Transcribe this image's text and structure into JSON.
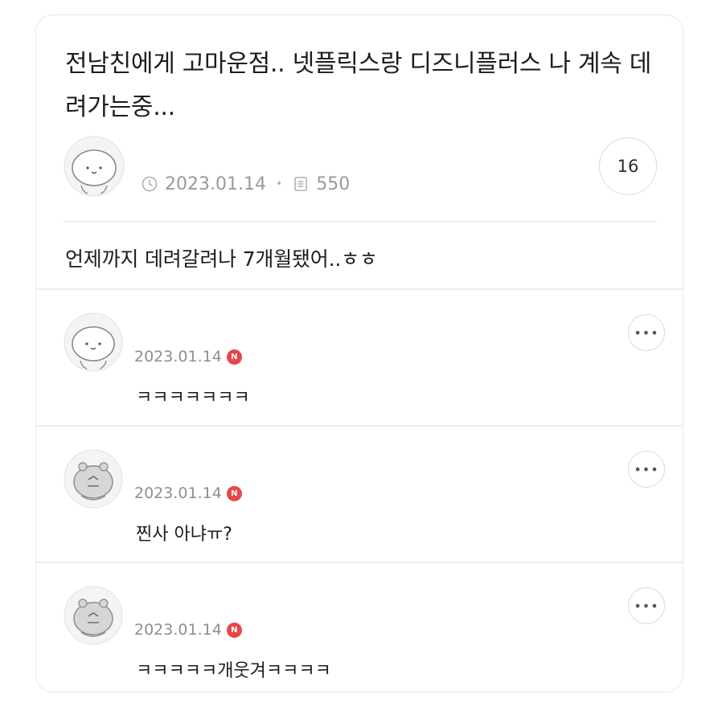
{
  "post": {
    "title": "전남친에게 고마운점.. 넷플릭스랑 디즈니플러스 나 계속 데려가는중...",
    "date": "2023.01.14",
    "views": "550",
    "comment_count": "16",
    "body": "언제까지 데려갈려나 7개월됐어..ㅎㅎ",
    "icons": {
      "date": "clock-icon",
      "views": "document-icon"
    }
  },
  "comments": [
    {
      "date": "2023.01.14",
      "badge": "N",
      "text": "ㅋㅋㅋㅋㅋㅋㅋ",
      "avatar": "white-character-avatar"
    },
    {
      "date": "2023.01.14",
      "badge": "N",
      "text": "찐사 아냐ㅠ?",
      "avatar": "gray-character-avatar"
    },
    {
      "date": "2023.01.14",
      "badge": "N",
      "text": "ㅋㅋㅋㅋㅋ개웃겨ㅋㅋㅋㅋ",
      "avatar": "gray-character-avatar"
    }
  ],
  "colors": {
    "badge_red": "#e5474b",
    "meta_gray": "#9a9a9a",
    "border": "#e8e8e8"
  }
}
